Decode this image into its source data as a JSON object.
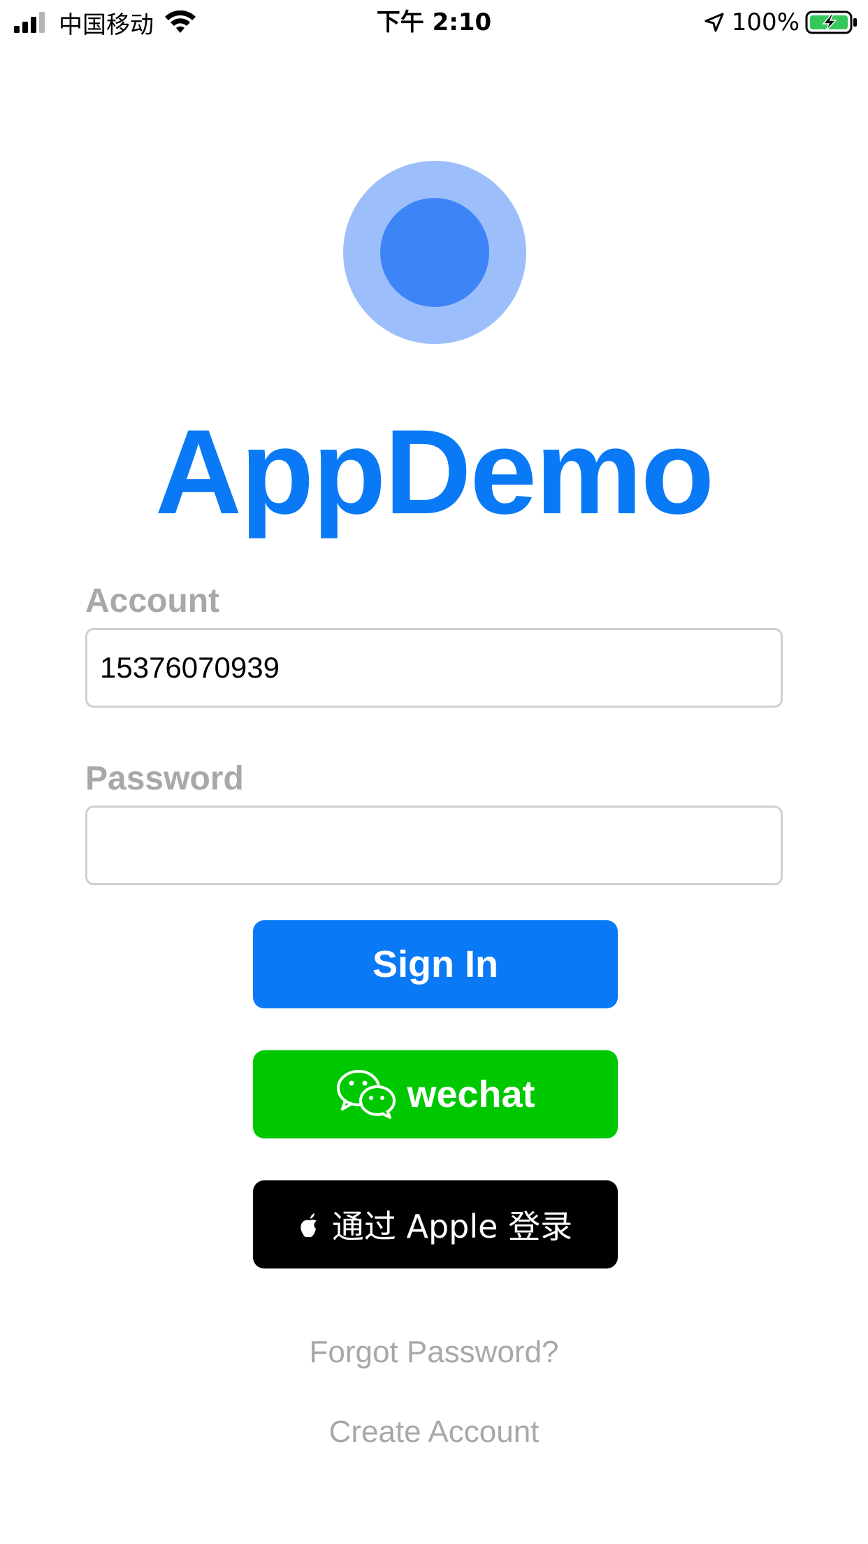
{
  "status_bar": {
    "carrier": "中国移动",
    "time": "下午 2:10",
    "battery": "100%"
  },
  "app": {
    "title": "AppDemo"
  },
  "form": {
    "account_label": "Account",
    "account_value": "15376070939",
    "password_label": "Password",
    "password_value": ""
  },
  "buttons": {
    "sign_in": "Sign In",
    "wechat": "wechat",
    "apple": "通过 Apple 登录"
  },
  "links": {
    "forgot_password": "Forgot Password?",
    "create_account": "Create Account"
  },
  "colors": {
    "primary": "#0a79f6",
    "wechat": "#00c800",
    "apple": "#000000",
    "label_gray": "#a8a8a8",
    "logo_outer": "#9cbffb",
    "logo_inner": "#3d84f7",
    "battery_fill": "#34c759"
  }
}
